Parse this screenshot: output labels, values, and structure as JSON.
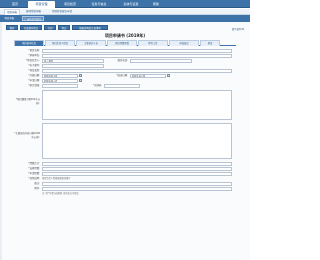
{
  "topnav": {
    "items": [
      "首页",
      "项目管理",
      "项目检查",
      "任务与信息",
      "系统与设置",
      "帮助"
    ],
    "active": 1
  },
  "subnav": {
    "items": [
      "项目申报",
      "基地项目申报",
      "项目检查报告申请"
    ],
    "active": 0
  },
  "crumbs": {
    "items": [
      "项目申报",
      "广州项目申请书"
    ],
    "active": 1
  },
  "toolbar": {
    "buttons": [
      "保存",
      "完成保存提交",
      "打印",
      "提交",
      "填报说明及注意事项"
    ]
  },
  "help_link": "填写说明 ▼",
  "page_title": "项目申请书 (2019年)",
  "form_tabs": {
    "items": [
      "项目基本信息",
      "项目负责人情况",
      "主要研究人员",
      "项目经费预算",
      "附件上传",
      "审核意见",
      "预览"
    ],
    "active": 0
  },
  "form": {
    "project_name_label": "*项目名称:",
    "project_name": "",
    "unit_label": "*承担单位:",
    "unit": "",
    "leader_label": "*项目负责人:",
    "leader": "张三项目",
    "phone_label": "联系电话:",
    "phone": "",
    "email_label": "*电子邮件:",
    "email": "",
    "type_label": "*项目类别:",
    "type": "",
    "start_label": "*开始日期:",
    "start": "2019-01-01",
    "end_label": "*结束日期:",
    "end": "2019-12-31",
    "apply_label": "*申请日期:",
    "apply": "2019-01-17",
    "field_label": "*研究领域:",
    "field": "",
    "keywords_label": "*关键词:",
    "keywords": "",
    "summary_label": "*项目摘要 (限500字以内):",
    "content_label": "*主要研究内容 (限1000字以内):",
    "budget_label": "*经费合计:",
    "budget": "",
    "self_label": "*自筹经费:",
    "self": "",
    "apply_budget_label": "*申请经费:",
    "apply_budget": "",
    "other_label": "*其他说明:",
    "other_hint": "项目负责人需要按照要求填写",
    "remark_label": "备注:",
    "remark": "",
    "attach_label": "附件:",
    "attach": "",
    "bottom_note": "注: 带*号项为必填项, 保存后方可提交"
  }
}
